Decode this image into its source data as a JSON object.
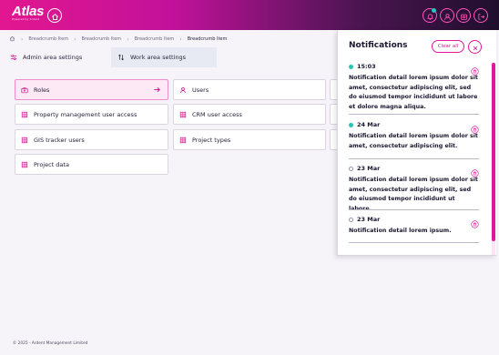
{
  "header": {
    "logo_main": "Atlas",
    "logo_sub": "Powered by Ardent",
    "icons": [
      "home-icon",
      "bell-icon",
      "user-icon",
      "settings-icon",
      "logout-icon"
    ]
  },
  "breadcrumb": {
    "items": [
      "Breadcrumb Item",
      "Breadcrumb Item",
      "Breadcrumb Item",
      "Breadcrumb Item"
    ],
    "current": "Breadcrumb Item"
  },
  "tabs": [
    {
      "label": "Admin area settings",
      "icon": "sliders-icon"
    },
    {
      "label": "Work area settings",
      "icon": "sort-icon"
    }
  ],
  "settings_items": [
    {
      "label": "Roles",
      "icon": "briefcase-icon",
      "active": true
    },
    {
      "label": "Users",
      "icon": "user-icon"
    },
    {
      "label": "Property management user access",
      "icon": "grid-icon"
    },
    {
      "label": "CRM user access",
      "icon": "grid-icon"
    },
    {
      "label": "GIS tracker users",
      "icon": "grid-icon"
    },
    {
      "label": "Project types",
      "icon": "grid-icon"
    },
    {
      "label": "Project data",
      "icon": "grid-icon"
    }
  ],
  "notifications": {
    "title": "Notifications",
    "clear_all_label": "Clear all",
    "items": [
      {
        "date": "15:03",
        "unread": true,
        "text": "Notification detail lorem ipsum dolor sit amet, consectetur adipiscing elit, sed do eiusmod tempor incididunt ut labore et dolore magna aliqua."
      },
      {
        "date": "24 Mar",
        "unread": true,
        "text": "Notification detail lorem ipsum dolor sit amet, consectetur adipiscing elit."
      },
      {
        "date": "23 Mar",
        "unread": false,
        "text": "Notification detail lorem ipsum dolor sit amet, consectetur adipiscing elit, sed do eiusmod tempor incididunt ut labore."
      },
      {
        "date": "23 Mar",
        "unread": false,
        "text": "Notification detail lorem ipsum."
      }
    ]
  },
  "footer": {
    "text": "© 2025 - Ardent Management Limited"
  },
  "colors": {
    "accent": "#e0179a",
    "unread_dot": "#22c6b3",
    "active_item_bg": "#fde9f5"
  }
}
